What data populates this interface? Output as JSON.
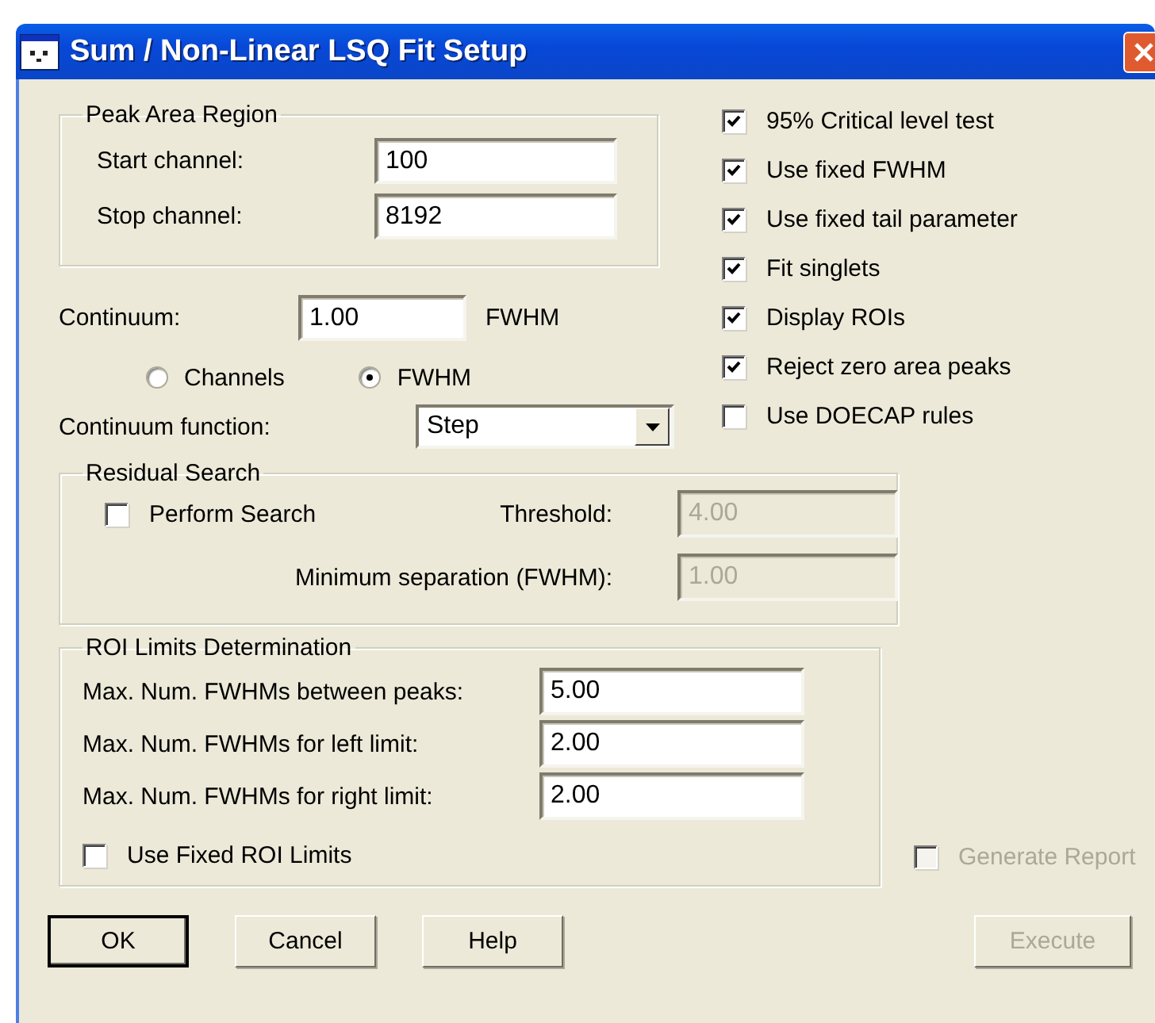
{
  "window": {
    "title": "Sum / Non-Linear LSQ Fit Setup"
  },
  "peak_area_region": {
    "title": "Peak Area Region",
    "fields": [
      {
        "label": "Start channel:",
        "value": "100"
      },
      {
        "label": "Stop channel:",
        "value": "8192"
      }
    ]
  },
  "continuum": {
    "label": "Continuum:",
    "value": "1.00",
    "unit": "FWHM",
    "units": [
      {
        "label": "Channels",
        "selected": false
      },
      {
        "label": "FWHM",
        "selected": true
      }
    ]
  },
  "continuum_function": {
    "label": "Continuum function:",
    "value": "Step"
  },
  "options": [
    {
      "label": "95% Critical level test",
      "checked": true
    },
    {
      "label": "Use fixed FWHM",
      "checked": true
    },
    {
      "label": "Use fixed tail parameter",
      "checked": true
    },
    {
      "label": "Fit singlets",
      "checked": true
    },
    {
      "label": "Display ROIs",
      "checked": true
    },
    {
      "label": "Reject zero area peaks",
      "checked": true
    },
    {
      "label": "Use DOECAP rules",
      "checked": false
    }
  ],
  "residual_search": {
    "title": "Residual Search",
    "perform": {
      "label": "Perform Search",
      "checked": false
    },
    "fields": [
      {
        "label": "Threshold:",
        "value": "4.00",
        "disabled": true
      },
      {
        "label": "Minimum separation (FWHM):",
        "value": "1.00",
        "disabled": true
      }
    ]
  },
  "roi_limits": {
    "title": "ROI Limits Determination",
    "fields": [
      {
        "label": "Max. Num. FWHMs between peaks:",
        "value": "5.00"
      },
      {
        "label": "Max. Num. FWHMs for left limit:",
        "value": "2.00"
      },
      {
        "label": "Max. Num. FWHMs for right limit:",
        "value": "2.00"
      }
    ],
    "fixed": {
      "label": "Use Fixed ROI Limits",
      "checked": false
    }
  },
  "generate_report": {
    "label": "Generate Report",
    "checked": false,
    "disabled": true
  },
  "buttons": [
    {
      "label": "OK",
      "default": true,
      "disabled": false
    },
    {
      "label": "Cancel",
      "default": false,
      "disabled": false
    },
    {
      "label": "Help",
      "default": false,
      "disabled": false
    },
    {
      "label": "Execute",
      "default": false,
      "disabled": true
    }
  ]
}
